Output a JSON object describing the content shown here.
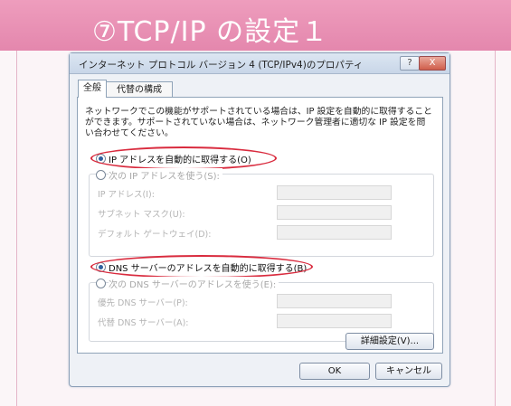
{
  "banner": {
    "title": "⑦TCP/IP の設定１"
  },
  "dialog": {
    "title": "インターネット プロトコル バージョン 4 (TCP/IPv4)のプロパティ",
    "help_label": "?",
    "close_label": "X",
    "tabs": [
      {
        "label": "全般"
      },
      {
        "label": "代替の構成"
      }
    ],
    "description": "ネットワークでこの機能がサポートされている場合は、IP 設定を自動的に取得することができます。サポートされていない場合は、ネットワーク管理者に適切な IP 設定を問い合わせてください。",
    "ip_auto_label": "IP アドレスを自動的に取得する(O)",
    "ip_manual_label": "次の IP アドレスを使う(S):",
    "ip_fields": [
      {
        "label": "IP アドレス(I):"
      },
      {
        "label": "サブネット マスク(U):"
      },
      {
        "label": "デフォルト ゲートウェイ(D):"
      }
    ],
    "dns_auto_label": "DNS サーバーのアドレスを自動的に取得する(B)",
    "dns_manual_label": "次の DNS サーバーのアドレスを使う(E):",
    "dns_fields": [
      {
        "label": "優先 DNS サーバー(P):"
      },
      {
        "label": "代替 DNS サーバー(A):"
      }
    ],
    "advanced_label": "詳細設定(V)...",
    "ok_label": "OK",
    "cancel_label": "キャンセル"
  },
  "colors": {
    "banner": "#e487ad",
    "highlight": "#d92b3e"
  }
}
